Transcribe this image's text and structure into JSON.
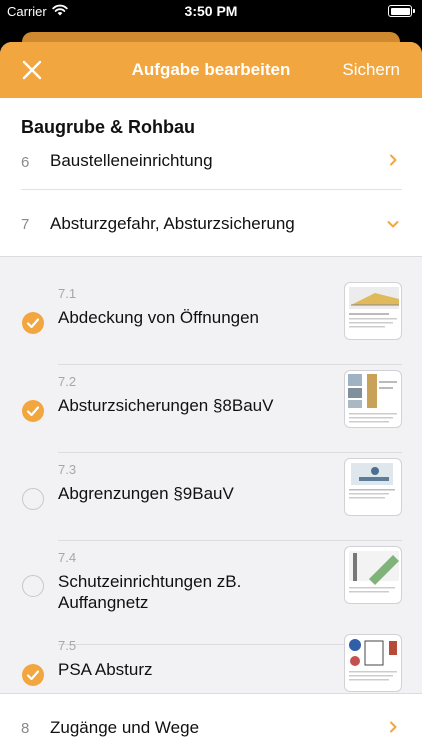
{
  "status_bar": {
    "carrier": "Carrier",
    "time": "3:50 PM"
  },
  "navbar": {
    "title": "Aufgabe bearbeiten",
    "save_label": "Sichern"
  },
  "section": {
    "title": "Baugrube & Rohbau"
  },
  "groups": [
    {
      "number": "6",
      "label": "Baustelleneinrichtung",
      "expanded": false
    },
    {
      "number": "7",
      "label": "Absturzgefahr, Absturzsicherung",
      "expanded": true
    }
  ],
  "sub_items": [
    {
      "number": "7.1",
      "label": "Abdeckung von Öffnungen",
      "checked": true
    },
    {
      "number": "7.2",
      "label": "Absturzsicherungen §8BauV",
      "checked": true
    },
    {
      "number": "7.3",
      "label": "Abgrenzungen §9BauV",
      "checked": false
    },
    {
      "number": "7.4",
      "label": "Schutzeinrichtungen zB. Auffangnetz",
      "checked": false
    },
    {
      "number": "7.5",
      "label": "PSA Absturz",
      "checked": true
    }
  ],
  "footer_group": {
    "number": "8",
    "label": "Zugänge und Wege",
    "expanded": false
  },
  "colors": {
    "accent": "#f2a63f",
    "background": "#f2f2f4"
  }
}
